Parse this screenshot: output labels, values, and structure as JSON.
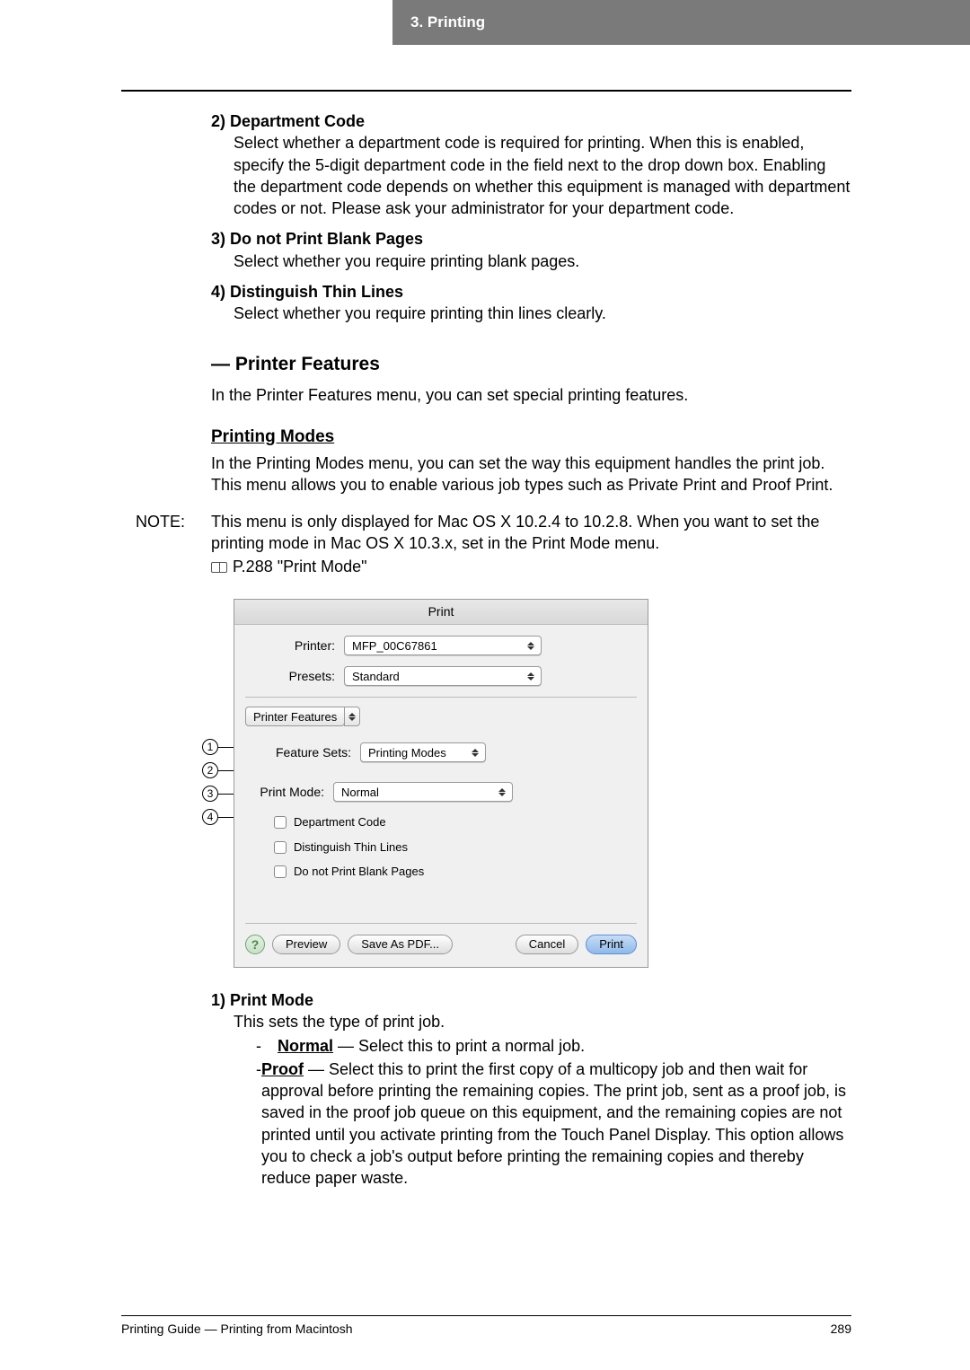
{
  "header": {
    "chapter": "3.  Printing"
  },
  "items_top": [
    {
      "num": "2)",
      "title": "Department Code",
      "body": "Select whether a department code is required for printing. When this is enabled, specify the 5-digit department code in the field next to the drop down box. Enabling the department code depends on whether this equipment is managed with department codes or not.  Please ask your administrator for your department code."
    },
    {
      "num": "3)",
      "title": "Do not Print Blank Pages",
      "body": "Select whether you require printing blank pages."
    },
    {
      "num": "4)",
      "title": "Distinguish Thin Lines",
      "body": "Select whether you require printing thin lines clearly."
    }
  ],
  "section_heading": "— Printer Features",
  "section_intro": "In the Printer Features menu, you can set special printing features.",
  "sub_heading": "Printing Modes",
  "sub_body": "In the Printing Modes menu, you can set the way this equipment handles the print job. This menu allows you to enable various job types such as Private Print and Proof Print.",
  "note_label": "NOTE:",
  "note_body": "This menu is only displayed for Mac OS X 10.2.4 to 10.2.8.  When you want to set the printing mode in Mac OS X 10.3.x, set in the Print Mode menu.",
  "note_ref": "P.288 \"Print Mode\"",
  "dialog": {
    "title": "Print",
    "printer_label": "Printer:",
    "printer_value": "MFP_00C67861",
    "presets_label": "Presets:",
    "presets_value": "Standard",
    "tab_value": "Printer Features",
    "feature_sets_label": "Feature Sets:",
    "feature_sets_value": "Printing Modes",
    "print_mode_label": "Print Mode:",
    "print_mode_value": "Normal",
    "cb1": "Department Code",
    "cb2": "Distinguish Thin Lines",
    "cb3": "Do not Print Blank Pages",
    "help": "?",
    "preview": "Preview",
    "save_pdf": "Save As PDF...",
    "cancel": "Cancel",
    "print": "Print"
  },
  "callout_nums": [
    "1",
    "2",
    "3",
    "4"
  ],
  "below_item": {
    "num": "1)",
    "title": "Print Mode",
    "intro": "This sets the type of print job.",
    "opts": [
      {
        "name": "Normal",
        "text": " — Select this to print a normal job."
      },
      {
        "name": "Proof",
        "text": " — Select this to print the first copy of a multicopy job and then wait for approval before printing the remaining copies.  The print job, sent as a proof job, is saved in the proof job queue on this equipment, and the remaining copies are not printed until you activate printing from the Touch Panel Display.  This option allows you to check a job's output before printing the remaining copies and thereby reduce paper waste."
      }
    ]
  },
  "footer": {
    "left": "Printing Guide — Printing from Macintosh",
    "right": "289"
  }
}
